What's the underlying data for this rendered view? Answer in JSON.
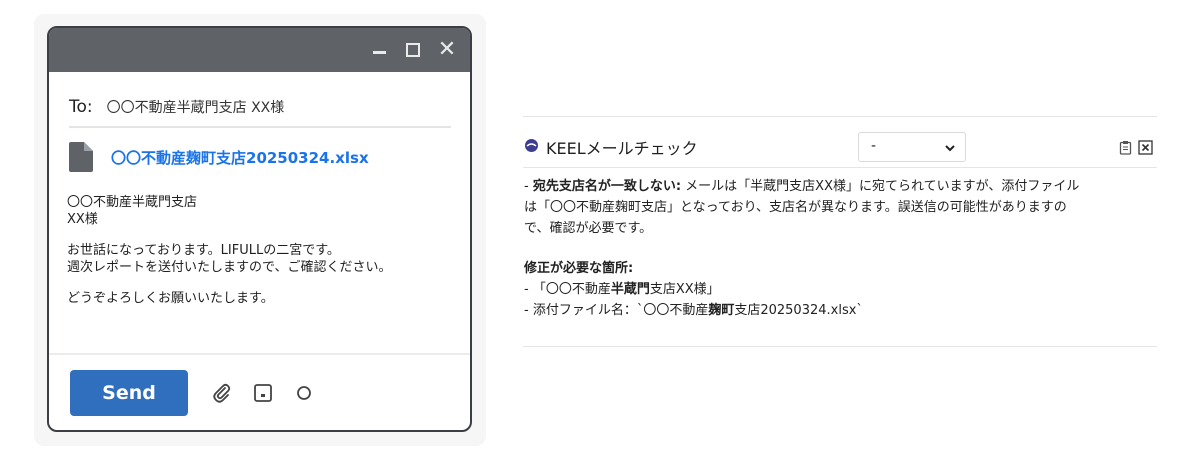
{
  "compose": {
    "to_label": "To:",
    "to_value": "〇〇不動産半蔵門支店 XX様",
    "attachment_name": "〇〇不動産麹町支店20250324.xlsx",
    "body_lines": [
      "〇〇不動産半蔵門支店",
      "XX様",
      "お世話になっております。LIFULLの二宮です。",
      "週次レポートを送付いたしますので、ご確認ください。",
      "どうぞよろしくお願いいたします。"
    ],
    "send_label": "Send",
    "close_glyph": "✕"
  },
  "panel": {
    "title": "KEELメールチェック",
    "select_value": "-",
    "issue_prefix": "- ",
    "issue_title": "宛先支店名が一致しない:",
    "issue_text_1": " メールは「半蔵門支店XX様」に宛てられていますが、添付ファイル",
    "issue_text_2": "は「〇〇不動産麹町支店」となっており、支店名が異なります。誤送信の可能性がありますの",
    "issue_text_3": "で、確認が必要です。",
    "fix_title": "修正が必要な箇所:",
    "fix_1_a": "- 「〇〇不動産",
    "fix_1_b": "半蔵門",
    "fix_1_c": "支店XX様」",
    "fix_2_a": "- 添付ファイル名：`〇〇不動産",
    "fix_2_b": "麹町",
    "fix_2_c": "支店20250324.xlsx`"
  },
  "colors": {
    "titlebar": "#5f6368",
    "send_button": "#2f6fbe",
    "attachment_link": "#1a73e8"
  },
  "icons": [
    "minimize-icon",
    "maximize-icon",
    "close-icon",
    "file-icon",
    "paperclip-icon",
    "image-icon",
    "more-icon",
    "keel-logo-icon",
    "chevron-down-icon",
    "clipboard-icon",
    "close-box-icon"
  ]
}
